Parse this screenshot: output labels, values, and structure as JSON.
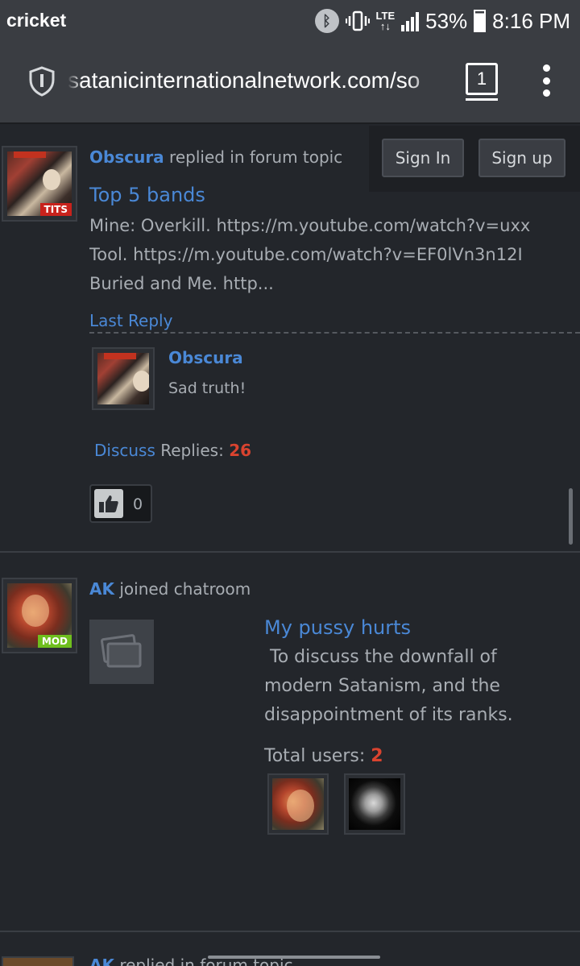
{
  "status_bar": {
    "carrier": "cricket",
    "network": "LTE",
    "battery": "53%",
    "time": "8:16 PM",
    "icons": [
      "bluetooth-icon",
      "vibrate-icon",
      "lte-icon",
      "signal-icon",
      "battery-icon"
    ]
  },
  "browser": {
    "url": "satanicinternationalnetwork.com/so",
    "tab_count": "1",
    "icons": [
      "shield-icon",
      "menu-icon"
    ]
  },
  "auth": {
    "sign_in": "Sign In",
    "sign_up": "Sign up"
  },
  "feed": [
    {
      "author": "Obscura",
      "action": "replied in forum topic",
      "avatar_badge": "TITS",
      "topic": "Top 5 bands",
      "excerpt_lines": [
        "Mine: Overkill.  https://m.youtube.com/watch?v=uxx",
        "Tool. https://m.youtube.com/watch?v=EF0lVn3n12I",
        "Buried and Me. http..."
      ],
      "last_reply_label": "Last Reply",
      "last_reply": {
        "author": "Obscura",
        "text": "Sad truth!"
      },
      "discuss_label": "Discuss",
      "replies_label": "Replies:",
      "replies_count": "26",
      "likes": "0"
    },
    {
      "author": "AK",
      "action": "joined chatroom",
      "avatar_badge": "MOD",
      "chatroom_title": "My pussy hurts",
      "chatroom_description": " To discuss the downfall of modern Satanism, and the disappointment of its ranks.",
      "total_users_label": "Total users:",
      "total_users": "2"
    },
    {
      "author": "AK",
      "action": "replied in forum topic"
    }
  ],
  "colors": {
    "background": "#23262b",
    "link": "#4a88d6",
    "count_red": "#d9432f",
    "mod_badge": "#6fbf1e",
    "tits_badge": "#c8221c"
  }
}
